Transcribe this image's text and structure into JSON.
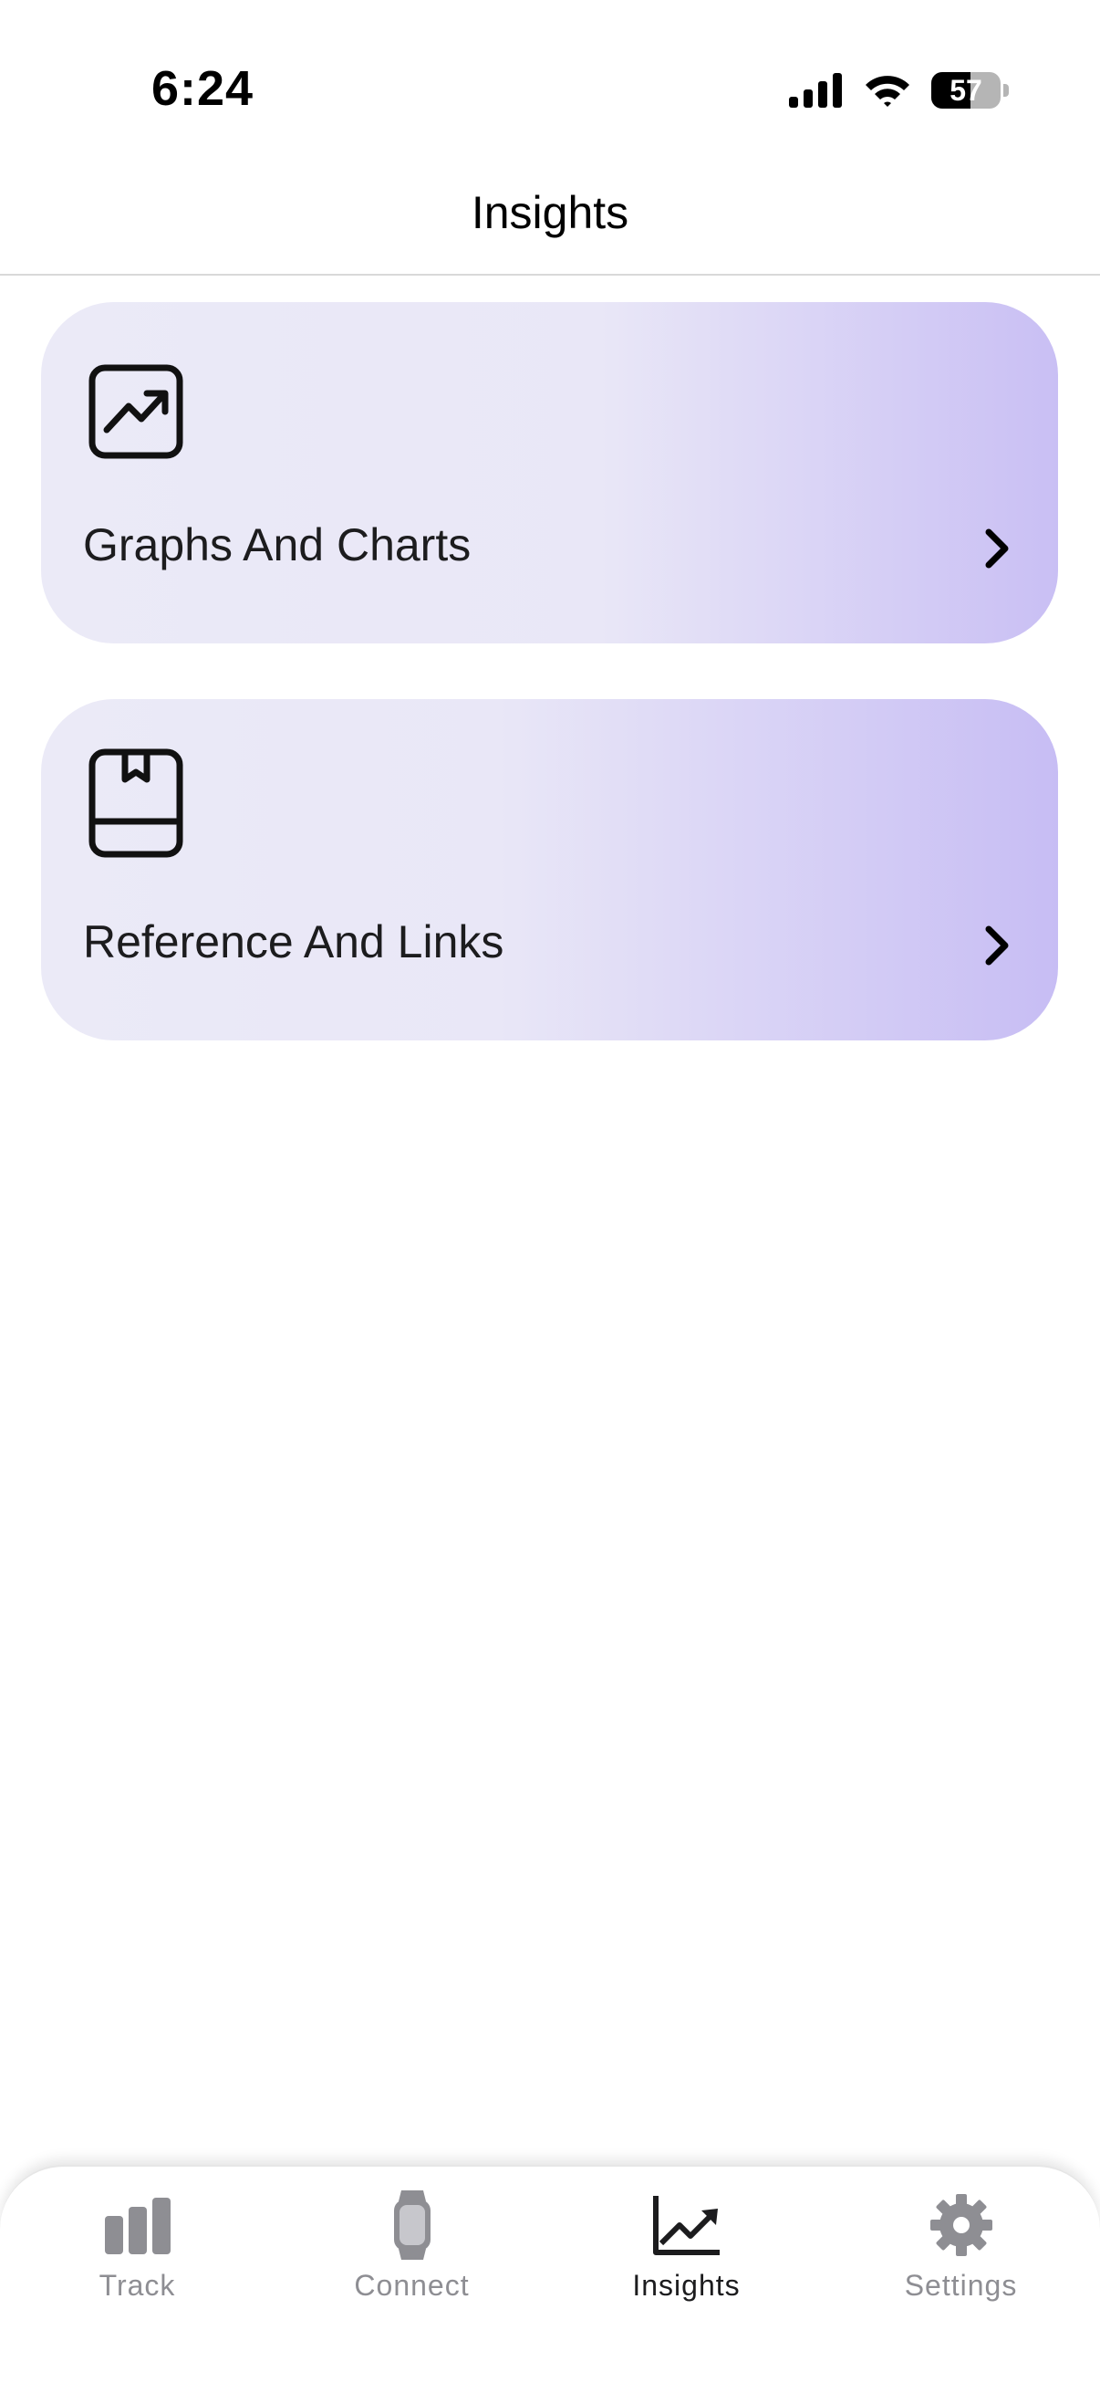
{
  "status_bar": {
    "time": "6:24",
    "battery_level": "57",
    "battery_fraction": 0.57
  },
  "header": {
    "title": "Insights"
  },
  "cards": [
    {
      "label": "Graphs And Charts",
      "icon": "line-chart-icon"
    },
    {
      "label": "Reference And Links",
      "icon": "bookmark-book-icon"
    }
  ],
  "tab_bar": {
    "active": "Insights",
    "tabs": [
      {
        "label": "Track",
        "icon": "bar-chart-icon"
      },
      {
        "label": "Connect",
        "icon": "watch-icon"
      },
      {
        "label": "Insights",
        "icon": "trend-chart-icon"
      },
      {
        "label": "Settings",
        "icon": "gear-icon"
      }
    ]
  },
  "colors": {
    "card_gradient_start": "#ebeaf7",
    "card_gradient_end": "#c9bff4",
    "tab_inactive": "#8e8e93",
    "tab_active": "#1c1c1e"
  }
}
